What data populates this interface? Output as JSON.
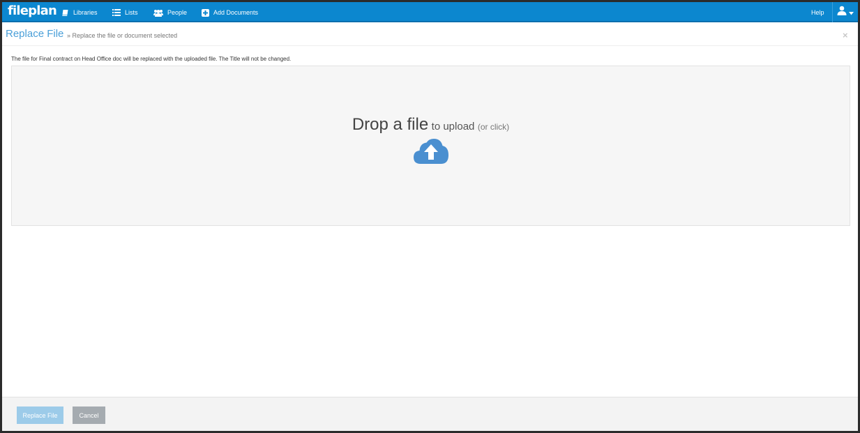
{
  "nav": {
    "logo": "fileplan",
    "items": [
      {
        "label": "Libraries",
        "icon": "book-icon"
      },
      {
        "label": "Lists",
        "icon": "list-icon"
      },
      {
        "label": "People",
        "icon": "users-icon"
      },
      {
        "label": "Add Documents",
        "icon": "plus-square-icon"
      }
    ],
    "help": "Help",
    "user_icon": "user-icon"
  },
  "header": {
    "title": "Replace File",
    "subtitle": "» Replace the file or document selected",
    "close": "×"
  },
  "info": "The file for Final contract on Head Office doc will be replaced with the uploaded file. The Title will not be changed.",
  "dropzone": {
    "main": "Drop a file",
    "sub": "to upload",
    "hint": "(or click)",
    "icon": "cloud-upload-icon"
  },
  "footer": {
    "replace": "Replace File",
    "cancel": "Cancel"
  },
  "colors": {
    "navbar": "#0c87cf",
    "accent": "#4a9fd8",
    "cloud": "#4a8fd0"
  }
}
